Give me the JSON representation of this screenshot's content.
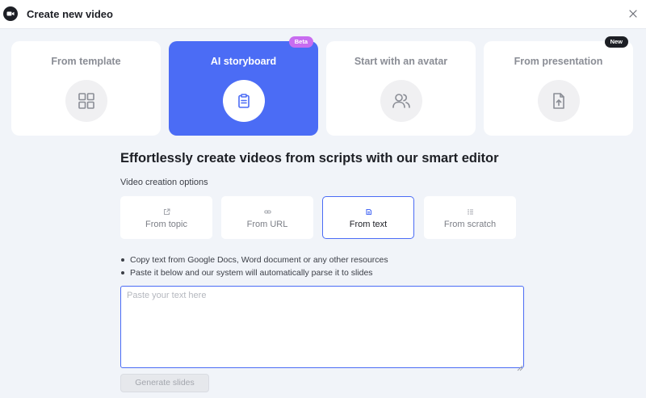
{
  "header": {
    "title": "Create new video",
    "logo_icon": "video-camera-icon",
    "close_icon": "close-icon"
  },
  "cards": [
    {
      "label": "From template",
      "icon": "grid-icon",
      "active": false
    },
    {
      "label": "AI storyboard",
      "icon": "clipboard-icon",
      "active": true,
      "badge": "Beta"
    },
    {
      "label": "Start with an avatar",
      "icon": "users-icon",
      "active": false
    },
    {
      "label": "From presentation",
      "icon": "file-upload-icon",
      "active": false,
      "badge": "New"
    }
  ],
  "main": {
    "headline": "Effortlessly create videos from scripts with our smart editor",
    "options_label": "Video creation options"
  },
  "options": [
    {
      "label": "From topic",
      "icon": "external-link-icon"
    },
    {
      "label": "From URL",
      "icon": "link-icon"
    },
    {
      "label": "From text",
      "icon": "text-icon",
      "selected": true
    },
    {
      "label": "From scratch",
      "icon": "list-icon"
    }
  ],
  "instructions": [
    "Copy text from Google Docs, Word document or any other resources",
    "Paste it below and our system will automatically parse it to slides"
  ],
  "input": {
    "value": "",
    "placeholder": "Paste your text here"
  },
  "generate_button": {
    "label": "Generate slides",
    "enabled": false
  },
  "colors": {
    "accent": "#4b6cf5",
    "beta_badge": "#c86cf0",
    "new_badge": "#1d1f25",
    "background": "#f1f4f9"
  }
}
